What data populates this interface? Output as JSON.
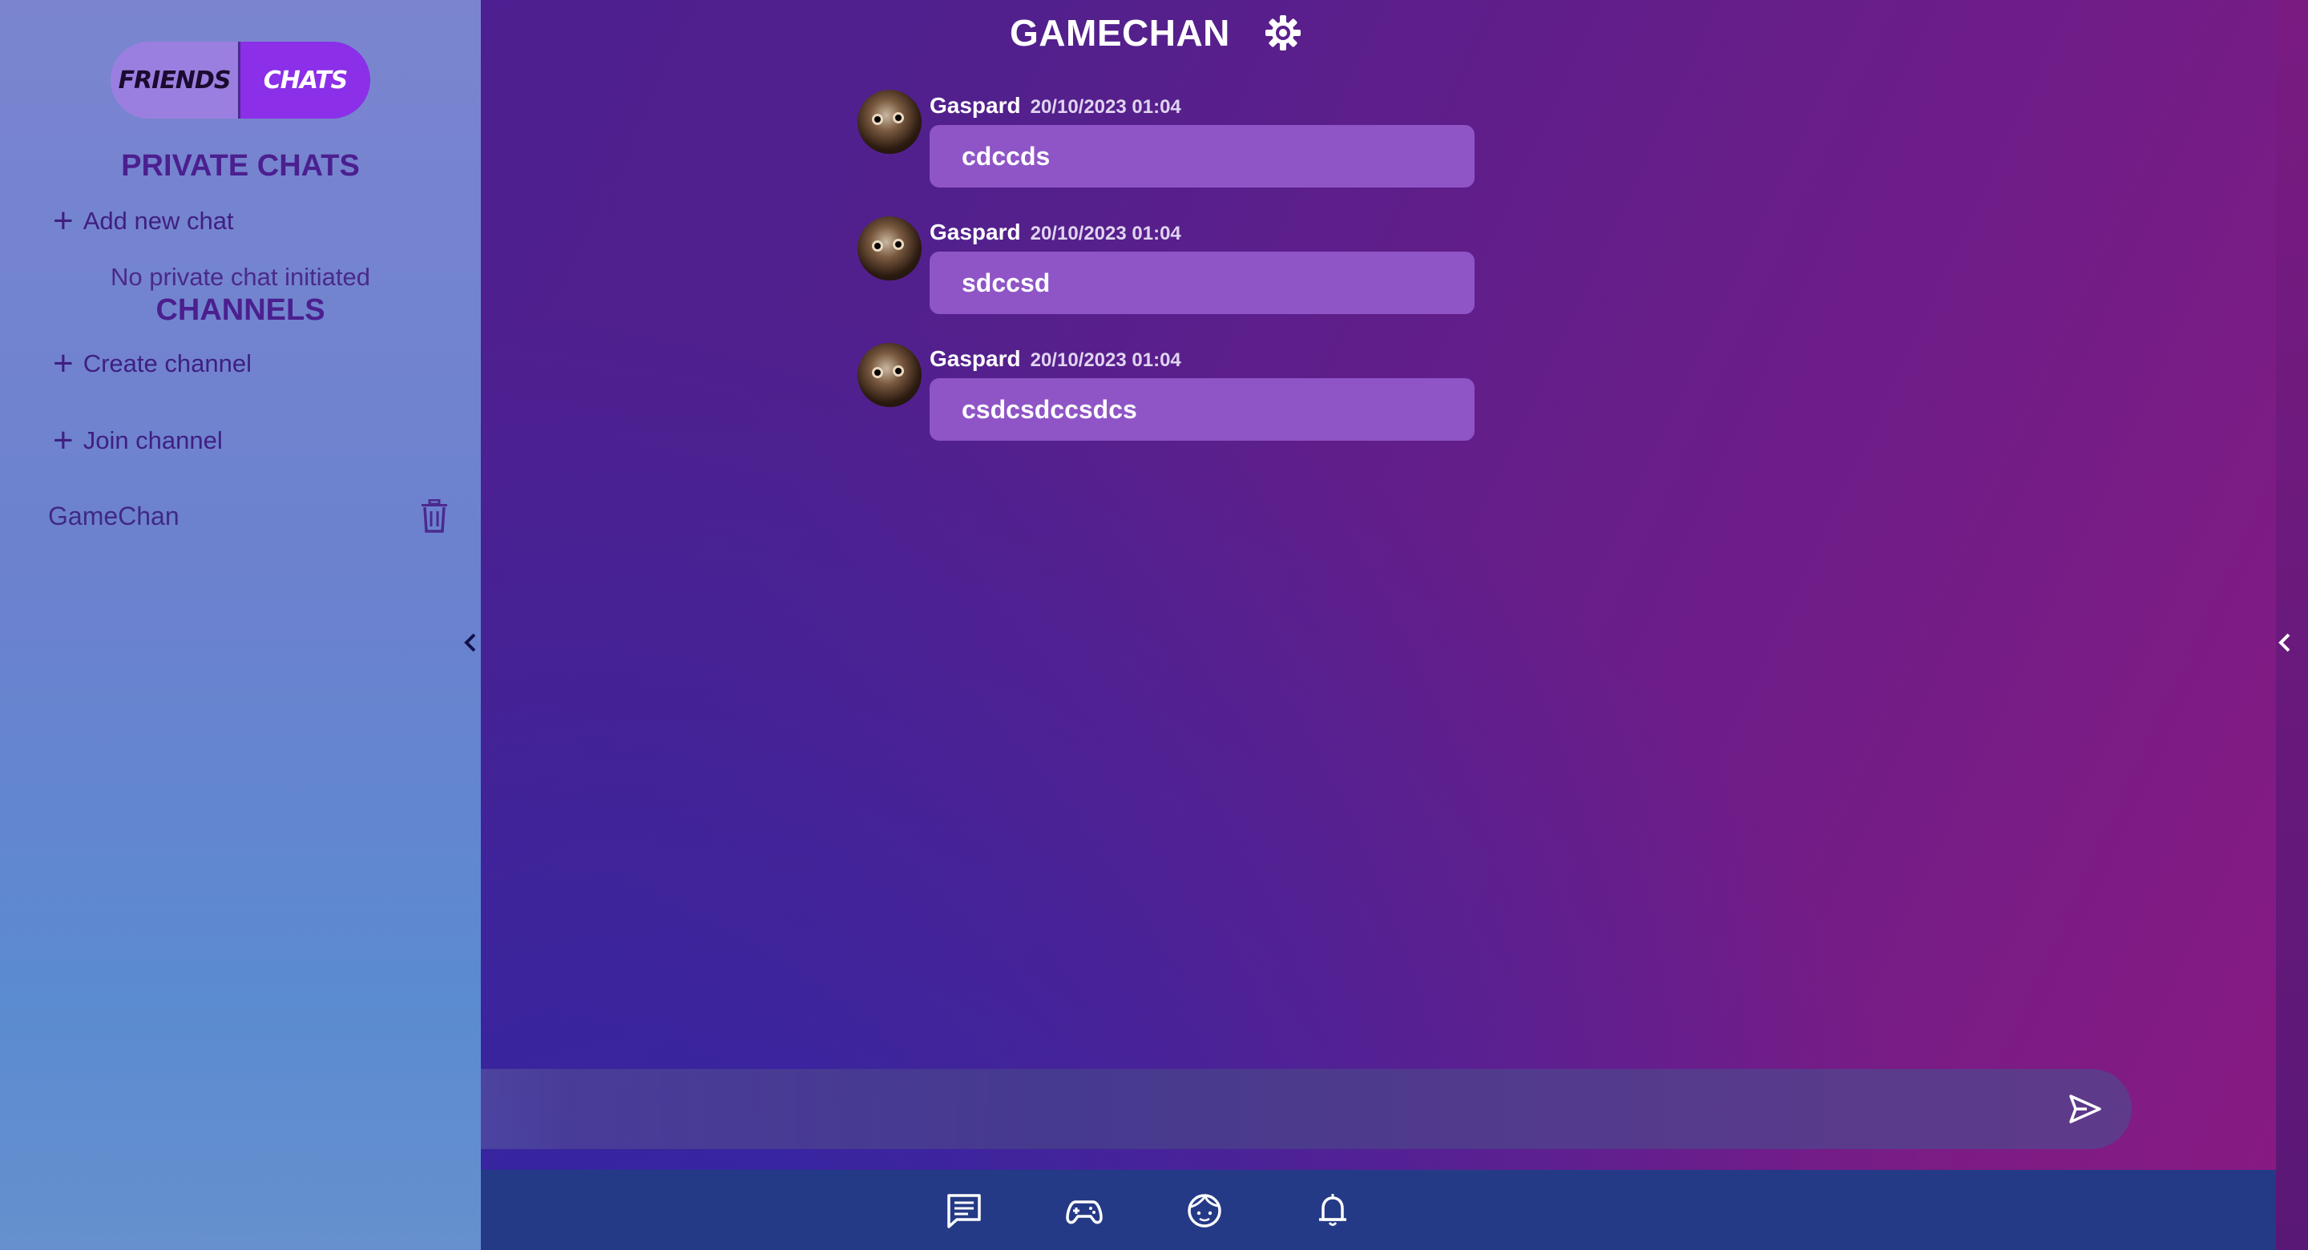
{
  "sidebar": {
    "toggle": {
      "friends_label": "FRIENDS",
      "chats_label": "CHATS",
      "active": "CHATS"
    },
    "private_chats_title": "PRIVATE CHATS",
    "add_new_chat_label": "Add new chat",
    "no_private_chat_text": "No private chat initiated",
    "channels_title": "CHANNELS",
    "create_channel_label": "Create channel",
    "join_channel_label": "Join channel",
    "channels": [
      {
        "name": "GameChan"
      }
    ]
  },
  "header": {
    "title": "GAMECHAN"
  },
  "messages": [
    {
      "author": "Gaspard",
      "time": "20/10/2023 01:04",
      "text": "cdccds"
    },
    {
      "author": "Gaspard",
      "time": "20/10/2023 01:04",
      "text": "sdccsd"
    },
    {
      "author": "Gaspard",
      "time": "20/10/2023 01:04",
      "text": "csdcsdccsdcs"
    }
  ],
  "composer": {
    "value": "",
    "placeholder": ""
  },
  "bottom_nav": {
    "items": [
      {
        "icon": "chat-icon"
      },
      {
        "icon": "gamepad-icon"
      },
      {
        "icon": "profile-face-icon"
      },
      {
        "icon": "bell-icon"
      }
    ]
  },
  "colors": {
    "accent": "#8b2fe8",
    "bubble": "#8f55c6",
    "sidebar_text": "#4b1f8f",
    "nav_bar": "#253a86"
  }
}
